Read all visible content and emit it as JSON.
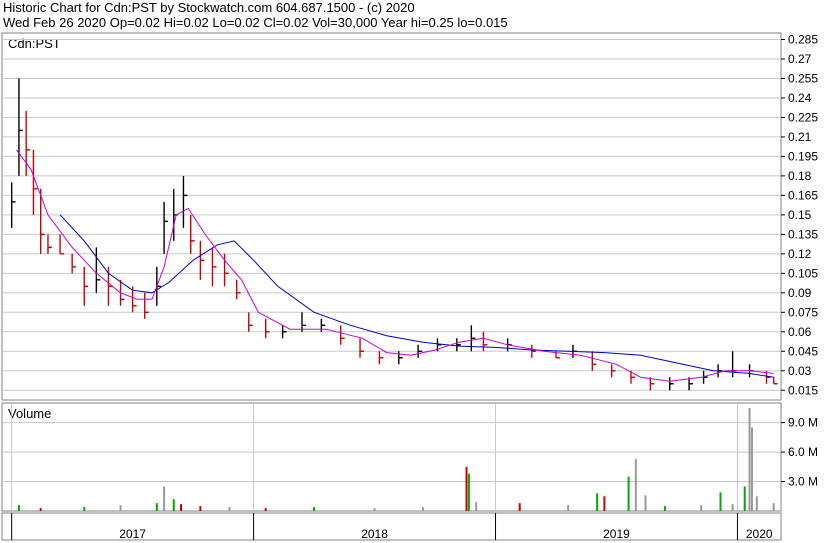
{
  "header": {
    "line1": "Historic Chart for Cdn:PST by Stockwatch.com 604.687.1500 - (c) 2020",
    "line2": "Wed Feb 26 2020   Op=0.02  Hi=0.02  Lo=0.02  Cl=0.02  Vol=30,000  Year hi=0.25  lo=0.015"
  },
  "colors": {
    "background": "#ffffff",
    "grid": "#c8c8c8",
    "bar_default": "#000000",
    "bar_down": "#cc0000",
    "ma_short": "#cc00cc",
    "ma_long": "#0000cc",
    "volume_up": "#00aa00",
    "volume_down": "#cc0000",
    "volume_neutral": "#999999"
  },
  "chart_data": [
    {
      "type": "line",
      "panel": "price",
      "title": "Cdn:PST",
      "y_ticks": [
        0.015,
        0.03,
        0.045,
        0.06,
        0.075,
        0.09,
        0.105,
        0.12,
        0.135,
        0.15,
        0.165,
        0.18,
        0.195,
        0.21,
        0.225,
        0.24,
        0.255,
        0.27,
        0.285
      ],
      "y_tick_labels": [
        "0.015",
        "0.03",
        "0.045",
        "0.06",
        "0.075",
        "0.09",
        "0.105",
        "0.12",
        "0.135",
        "0.15",
        "0.165",
        "0.18",
        "0.195",
        "0.21",
        "0.225",
        "0.24",
        "0.255",
        "0.27",
        "0.285"
      ],
      "ylim": [
        0.0075,
        0.29
      ],
      "x_range": [
        2016.96,
        2020.18
      ],
      "grid": true,
      "ohlc": [
        {
          "t": 2017.0,
          "h": 0.175,
          "l": 0.14,
          "c": 0.16
        },
        {
          "t": 2017.03,
          "h": 0.255,
          "l": 0.18,
          "c": 0.215
        },
        {
          "t": 2017.06,
          "h": 0.23,
          "l": 0.18,
          "c": 0.2
        },
        {
          "t": 2017.09,
          "h": 0.2,
          "l": 0.15,
          "c": 0.17
        },
        {
          "t": 2017.12,
          "h": 0.17,
          "l": 0.12,
          "c": 0.135
        },
        {
          "t": 2017.15,
          "h": 0.135,
          "l": 0.12,
          "c": 0.125
        },
        {
          "t": 2017.2,
          "h": 0.135,
          "l": 0.12,
          "c": 0.12
        },
        {
          "t": 2017.25,
          "h": 0.12,
          "l": 0.105,
          "c": 0.11
        },
        {
          "t": 2017.3,
          "h": 0.11,
          "l": 0.08,
          "c": 0.095
        },
        {
          "t": 2017.35,
          "h": 0.125,
          "l": 0.09,
          "c": 0.1
        },
        {
          "t": 2017.4,
          "h": 0.11,
          "l": 0.08,
          "c": 0.095
        },
        {
          "t": 2017.45,
          "h": 0.1,
          "l": 0.08,
          "c": 0.085
        },
        {
          "t": 2017.5,
          "h": 0.095,
          "l": 0.075,
          "c": 0.08
        },
        {
          "t": 2017.55,
          "h": 0.09,
          "l": 0.07,
          "c": 0.075
        },
        {
          "t": 2017.6,
          "h": 0.11,
          "l": 0.08,
          "c": 0.095
        },
        {
          "t": 2017.63,
          "h": 0.16,
          "l": 0.12,
          "c": 0.145
        },
        {
          "t": 2017.67,
          "h": 0.17,
          "l": 0.13,
          "c": 0.15
        },
        {
          "t": 2017.71,
          "h": 0.18,
          "l": 0.14,
          "c": 0.165
        },
        {
          "t": 2017.74,
          "h": 0.15,
          "l": 0.12,
          "c": 0.13
        },
        {
          "t": 2017.78,
          "h": 0.13,
          "l": 0.1,
          "c": 0.115
        },
        {
          "t": 2017.83,
          "h": 0.125,
          "l": 0.095,
          "c": 0.11
        },
        {
          "t": 2017.88,
          "h": 0.12,
          "l": 0.095,
          "c": 0.105
        },
        {
          "t": 2017.93,
          "h": 0.1,
          "l": 0.085,
          "c": 0.09
        },
        {
          "t": 2017.98,
          "h": 0.075,
          "l": 0.06,
          "c": 0.065
        },
        {
          "t": 2018.05,
          "h": 0.07,
          "l": 0.055,
          "c": 0.06
        },
        {
          "t": 2018.12,
          "h": 0.065,
          "l": 0.055,
          "c": 0.06
        },
        {
          "t": 2018.2,
          "h": 0.075,
          "l": 0.06,
          "c": 0.065
        },
        {
          "t": 2018.28,
          "h": 0.07,
          "l": 0.06,
          "c": 0.065
        },
        {
          "t": 2018.36,
          "h": 0.065,
          "l": 0.05,
          "c": 0.055
        },
        {
          "t": 2018.44,
          "h": 0.055,
          "l": 0.04,
          "c": 0.045
        },
        {
          "t": 2018.52,
          "h": 0.045,
          "l": 0.035,
          "c": 0.04
        },
        {
          "t": 2018.6,
          "h": 0.045,
          "l": 0.035,
          "c": 0.04
        },
        {
          "t": 2018.68,
          "h": 0.05,
          "l": 0.04,
          "c": 0.045
        },
        {
          "t": 2018.76,
          "h": 0.055,
          "l": 0.045,
          "c": 0.05
        },
        {
          "t": 2018.84,
          "h": 0.055,
          "l": 0.045,
          "c": 0.05
        },
        {
          "t": 2018.9,
          "h": 0.065,
          "l": 0.045,
          "c": 0.055
        },
        {
          "t": 2018.95,
          "h": 0.06,
          "l": 0.045,
          "c": 0.05
        },
        {
          "t": 2019.05,
          "h": 0.055,
          "l": 0.045,
          "c": 0.05
        },
        {
          "t": 2019.15,
          "h": 0.05,
          "l": 0.04,
          "c": 0.045
        },
        {
          "t": 2019.25,
          "h": 0.045,
          "l": 0.04,
          "c": 0.04
        },
        {
          "t": 2019.32,
          "h": 0.05,
          "l": 0.04,
          "c": 0.045
        },
        {
          "t": 2019.4,
          "h": 0.045,
          "l": 0.03,
          "c": 0.035
        },
        {
          "t": 2019.48,
          "h": 0.035,
          "l": 0.025,
          "c": 0.03
        },
        {
          "t": 2019.56,
          "h": 0.03,
          "l": 0.02,
          "c": 0.025
        },
        {
          "t": 2019.64,
          "h": 0.025,
          "l": 0.015,
          "c": 0.02
        },
        {
          "t": 2019.72,
          "h": 0.025,
          "l": 0.015,
          "c": 0.02
        },
        {
          "t": 2019.8,
          "h": 0.025,
          "l": 0.015,
          "c": 0.02
        },
        {
          "t": 2019.86,
          "h": 0.03,
          "l": 0.02,
          "c": 0.025
        },
        {
          "t": 2019.92,
          "h": 0.035,
          "l": 0.025,
          "c": 0.03
        },
        {
          "t": 2019.98,
          "h": 0.045,
          "l": 0.025,
          "c": 0.03
        },
        {
          "t": 2020.05,
          "h": 0.035,
          "l": 0.025,
          "c": 0.03
        },
        {
          "t": 2020.12,
          "h": 0.03,
          "l": 0.02,
          "c": 0.025
        },
        {
          "t": 2020.15,
          "h": 0.025,
          "l": 0.02,
          "c": 0.02
        }
      ],
      "series": [
        {
          "role": "short moving average",
          "color": "#cc00cc",
          "t": [
            2017.02,
            2017.08,
            2017.15,
            2017.25,
            2017.35,
            2017.45,
            2017.52,
            2017.58,
            2017.63,
            2017.68,
            2017.73,
            2017.8,
            2017.88,
            2017.95,
            2018.02,
            2018.15,
            2018.3,
            2018.45,
            2018.55,
            2018.65,
            2018.75,
            2018.85,
            2018.95,
            2019.05,
            2019.2,
            2019.35,
            2019.5,
            2019.6,
            2019.72,
            2019.85,
            2019.95,
            2020.05,
            2020.15
          ],
          "values": [
            0.2,
            0.185,
            0.15,
            0.125,
            0.105,
            0.09,
            0.085,
            0.085,
            0.11,
            0.15,
            0.155,
            0.135,
            0.115,
            0.1,
            0.075,
            0.062,
            0.062,
            0.055,
            0.044,
            0.042,
            0.046,
            0.052,
            0.055,
            0.05,
            0.045,
            0.042,
            0.035,
            0.025,
            0.022,
            0.025,
            0.03,
            0.03,
            0.028
          ]
        },
        {
          "role": "long moving average",
          "color": "#0000cc",
          "t": [
            2017.2,
            2017.3,
            2017.4,
            2017.5,
            2017.58,
            2017.65,
            2017.75,
            2017.85,
            2017.92,
            2018.0,
            2018.1,
            2018.25,
            2018.4,
            2018.55,
            2018.7,
            2018.85,
            2019.0,
            2019.15,
            2019.3,
            2019.45,
            2019.6,
            2019.75,
            2019.9,
            2020.05,
            2020.15
          ],
          "values": [
            0.15,
            0.13,
            0.105,
            0.092,
            0.09,
            0.098,
            0.115,
            0.127,
            0.13,
            0.115,
            0.095,
            0.075,
            0.065,
            0.057,
            0.052,
            0.049,
            0.048,
            0.046,
            0.045,
            0.044,
            0.042,
            0.036,
            0.03,
            0.028,
            0.025
          ]
        }
      ]
    },
    {
      "type": "bar",
      "panel": "volume",
      "title": "Volume",
      "y_ticks": [
        3.0,
        6.0,
        9.0
      ],
      "y_tick_labels": [
        "3.0 M",
        "6.0 M",
        "9.0 M"
      ],
      "ylim": [
        0,
        11.0
      ],
      "grid": true,
      "x_tick_labels": [
        "2017",
        "2018",
        "2019",
        "2020"
      ],
      "year_boundaries": [
        2017.0,
        2018.0,
        2019.0,
        2020.0
      ],
      "volume_bars": [
        {
          "t": 2017.03,
          "v": 0.6,
          "color": "green"
        },
        {
          "t": 2017.12,
          "v": 0.3,
          "color": "red"
        },
        {
          "t": 2017.3,
          "v": 0.4,
          "color": "green"
        },
        {
          "t": 2017.45,
          "v": 0.6,
          "color": "gray"
        },
        {
          "t": 2017.6,
          "v": 0.8,
          "color": "green"
        },
        {
          "t": 2017.63,
          "v": 2.5,
          "color": "gray"
        },
        {
          "t": 2017.67,
          "v": 1.2,
          "color": "green"
        },
        {
          "t": 2017.7,
          "v": 0.7,
          "color": "red"
        },
        {
          "t": 2017.78,
          "v": 0.5,
          "color": "red"
        },
        {
          "t": 2017.9,
          "v": 0.4,
          "color": "gray"
        },
        {
          "t": 2018.05,
          "v": 0.3,
          "color": "red"
        },
        {
          "t": 2018.25,
          "v": 0.4,
          "color": "green"
        },
        {
          "t": 2018.5,
          "v": 0.3,
          "color": "gray"
        },
        {
          "t": 2018.7,
          "v": 0.4,
          "color": "gray"
        },
        {
          "t": 2018.88,
          "v": 4.5,
          "color": "red"
        },
        {
          "t": 2018.89,
          "v": 3.8,
          "color": "green"
        },
        {
          "t": 2018.92,
          "v": 0.9,
          "color": "gray"
        },
        {
          "t": 2019.1,
          "v": 0.8,
          "color": "red"
        },
        {
          "t": 2019.3,
          "v": 0.6,
          "color": "gray"
        },
        {
          "t": 2019.42,
          "v": 1.8,
          "color": "green"
        },
        {
          "t": 2019.45,
          "v": 1.5,
          "color": "red"
        },
        {
          "t": 2019.55,
          "v": 3.5,
          "color": "green"
        },
        {
          "t": 2019.58,
          "v": 5.3,
          "color": "gray"
        },
        {
          "t": 2019.62,
          "v": 1.6,
          "color": "gray"
        },
        {
          "t": 2019.7,
          "v": 0.5,
          "color": "green"
        },
        {
          "t": 2019.85,
          "v": 0.6,
          "color": "gray"
        },
        {
          "t": 2019.93,
          "v": 1.9,
          "color": "green"
        },
        {
          "t": 2019.98,
          "v": 0.7,
          "color": "gray"
        },
        {
          "t": 2020.03,
          "v": 2.5,
          "color": "green"
        },
        {
          "t": 2020.05,
          "v": 10.5,
          "color": "gray"
        },
        {
          "t": 2020.06,
          "v": 8.5,
          "color": "gray"
        },
        {
          "t": 2020.08,
          "v": 1.5,
          "color": "gray"
        },
        {
          "t": 2020.15,
          "v": 0.8,
          "color": "gray"
        }
      ]
    }
  ]
}
